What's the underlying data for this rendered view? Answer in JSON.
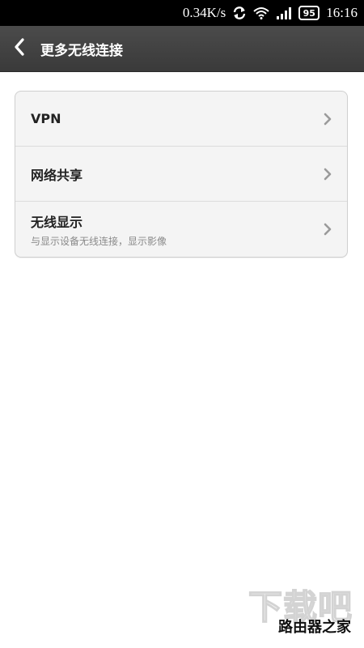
{
  "status_bar": {
    "network_speed": "0.34K/s",
    "battery_level": "95",
    "time": "16:16",
    "icons": [
      "sync-icon",
      "wifi-icon",
      "signal-icon",
      "battery-icon"
    ]
  },
  "header": {
    "back_icon": "back-chevron-icon",
    "title": "更多无线连接"
  },
  "settings": {
    "items": [
      {
        "label": "VPN",
        "subtitle": ""
      },
      {
        "label": "网络共享",
        "subtitle": ""
      },
      {
        "label": "无线显示",
        "subtitle": "与显示设备无线连接，显示影像"
      }
    ]
  },
  "watermark": {
    "top_text": "下载吧",
    "bottom_text": "路由器之家"
  },
  "colors": {
    "status_bar_bg": "#000000",
    "title_bar_bg": "#404040",
    "card_bg": "#f4f4f4",
    "page_bg": "#ffffff"
  }
}
